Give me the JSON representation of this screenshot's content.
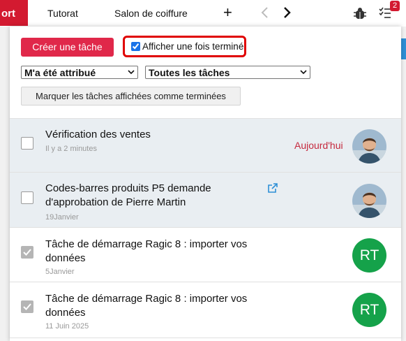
{
  "topbar": {
    "active_tab": "ort",
    "tabs": [
      "Tutorat",
      "Salon de coiffure"
    ],
    "plus": "+",
    "task_badge": "2"
  },
  "panel": {
    "create_label": "Créer une tâche",
    "show_completed_label": "Afficher une fois terminé",
    "show_completed_checked": true,
    "filter_assigned": "M'a été attribué",
    "filter_tasks": "Toutes les tâches",
    "mark_done_label": "Marquer les tâches affichées comme terminées"
  },
  "tasks": [
    {
      "title": "Vérification des ventes",
      "time": "Il y a 2 minutes",
      "due": "Aujourd'hui",
      "done": false,
      "avatar": "photo"
    },
    {
      "title": "Codes-barres produits P5 demande d'approbation de Pierre Martin",
      "time": "19Janvier",
      "due": "",
      "done": false,
      "avatar": "photo",
      "external_link": true
    },
    {
      "title": "Tâche de démarrage Ragic 8 : importer vos données",
      "time": "5Janvier",
      "due": "",
      "done": true,
      "avatar": "RT"
    },
    {
      "title": "Tâche de démarrage Ragic 8 : importer vos données",
      "time": "11 Juin 2025",
      "due": "",
      "done": true,
      "avatar": "RT"
    }
  ],
  "colors": {
    "accent": "#d31a30",
    "create_button": "#e0284a",
    "highlight": "#e00000",
    "rt_avatar": "#15a24a",
    "due_text": "#c5283d"
  }
}
